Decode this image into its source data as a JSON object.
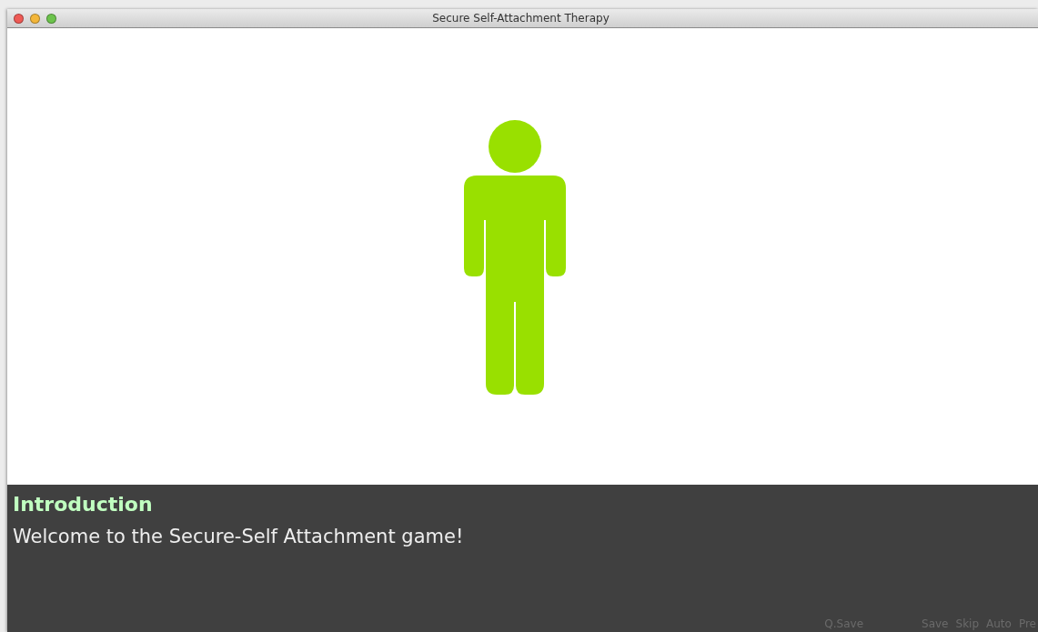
{
  "window": {
    "title": "Secure Self-Attachment Therapy"
  },
  "dialogue": {
    "speaker": "Introduction",
    "text": "Welcome to the Secure-Self Attachment game!"
  },
  "quick_menu": [
    {
      "label": "Q.Save"
    },
    {
      "label": "Save"
    },
    {
      "label": "Skip"
    },
    {
      "label": "Auto"
    },
    {
      "label": "Pre"
    }
  ]
}
